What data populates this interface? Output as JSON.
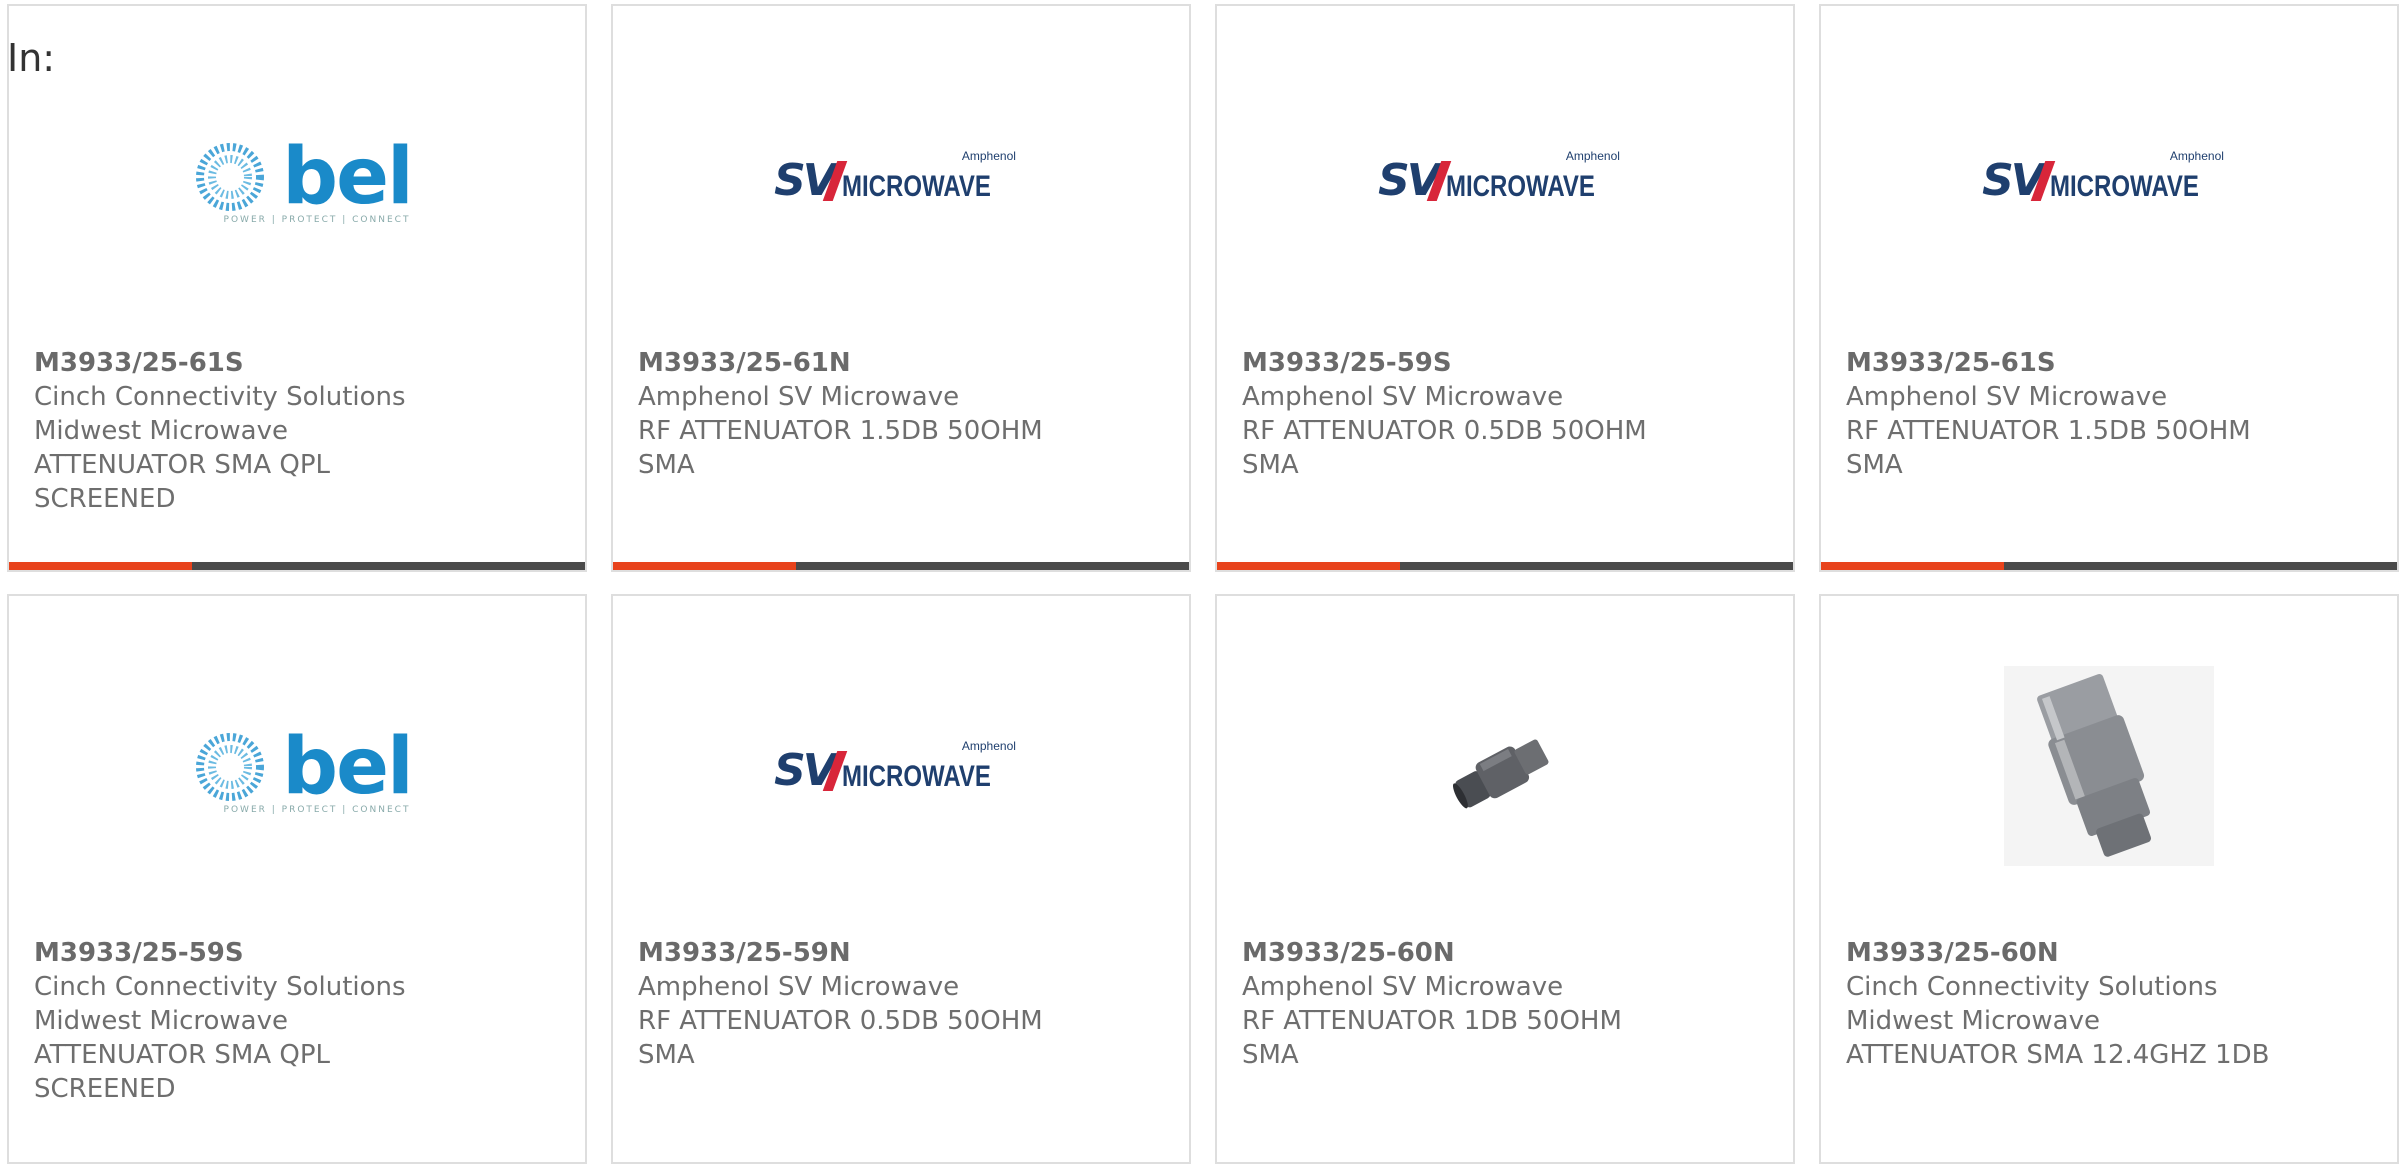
{
  "header": {
    "in_label": "In:"
  },
  "cards": [
    {
      "logo": "bel-logo",
      "part_number": "M3933/25-61S",
      "lines": [
        "Cinch Connectivity Solutions",
        "Midwest Microwave",
        "ATTENUATOR SMA QPL",
        "SCREENED"
      ]
    },
    {
      "logo": "sv-microwave-logo",
      "part_number": "M3933/25-61N",
      "lines": [
        "Amphenol SV Microwave",
        "RF ATTENUATOR 1.5DB 50OHM",
        "SMA"
      ]
    },
    {
      "logo": "sv-microwave-logo",
      "part_number": "M3933/25-59S",
      "lines": [
        "Amphenol SV Microwave",
        "RF ATTENUATOR 0.5DB 50OHM",
        "SMA"
      ]
    },
    {
      "logo": "sv-microwave-logo",
      "part_number": "M3933/25-61S",
      "lines": [
        "Amphenol SV Microwave",
        "RF ATTENUATOR 1.5DB 50OHM",
        "SMA"
      ]
    },
    {
      "logo": "bel-logo",
      "part_number": "M3933/25-59S",
      "lines": [
        "Cinch Connectivity Solutions",
        "Midwest Microwave",
        "ATTENUATOR SMA QPL",
        "SCREENED"
      ]
    },
    {
      "logo": "sv-microwave-logo",
      "part_number": "M3933/25-59N",
      "lines": [
        "Amphenol SV Microwave",
        "RF ATTENUATOR 0.5DB 50OHM",
        "SMA"
      ]
    },
    {
      "logo": "attenuator-small-photo",
      "part_number": "M3933/25-60N",
      "lines": [
        "Amphenol SV Microwave",
        "RF ATTENUATOR 1DB 50OHM",
        "SMA"
      ]
    },
    {
      "logo": "attenuator-large-photo",
      "part_number": "M3933/25-60N",
      "lines": [
        "Cinch Connectivity Solutions",
        "Midwest Microwave",
        "ATTENUATOR SMA 12.4GHZ 1DB"
      ]
    }
  ],
  "logos": {
    "bel_word": "bel",
    "bel_tagline": "POWER | PROTECT | CONNECT",
    "sv_letters": "SV",
    "sv_microwave": "MICROWAVE",
    "sv_amphenol": "Amphenol"
  },
  "colors": {
    "accent": "#e8431c",
    "bar": "#4a4a4a",
    "border": "#dedede",
    "text": "#6e6e6e"
  }
}
